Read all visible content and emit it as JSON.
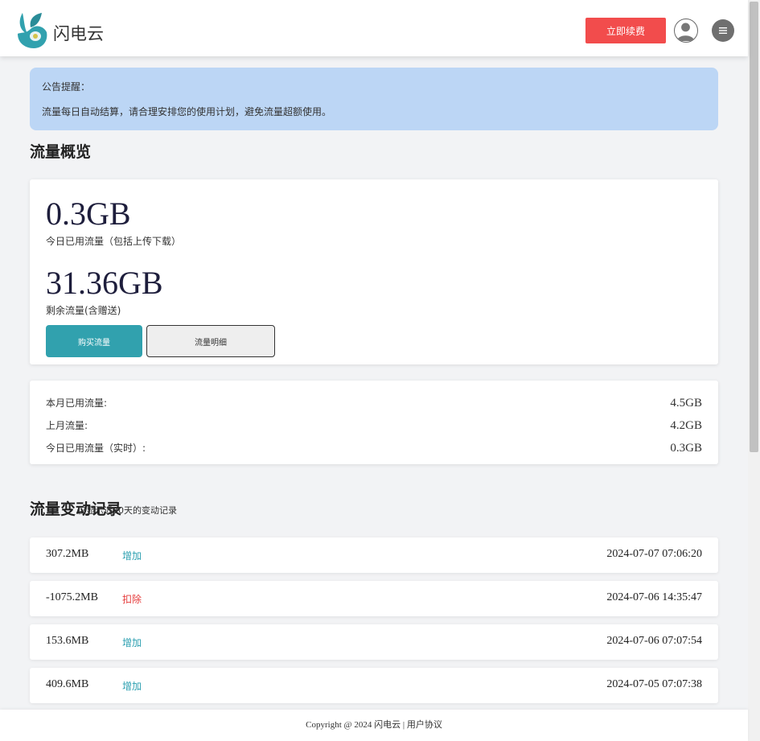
{
  "header": {
    "brand": "闪电云",
    "action_button": "立即续费",
    "avatar_icon": "user-avatar-icon",
    "menu_icon": "hamburger-menu-icon"
  },
  "notice": {
    "title": "公告提醒：",
    "body": "流量每日自动结算，请合理安排您的使用计划，避免流量超额使用。"
  },
  "summary": {
    "title": "流量概览",
    "today_value": "0.3GB",
    "today_label": "今日已用流量（包括上传下载）",
    "remaining_value": "31.36GB",
    "remaining_label": "剩余流量(含赠送)",
    "primary_button": "购买流量",
    "secondary_button": "流量明细"
  },
  "stats": [
    {
      "label": "本月已用流量:",
      "value": "4.5GB"
    },
    {
      "label": "上月流量:",
      "value": "4.2GB"
    },
    {
      "label": "今日已用流量（实时）:",
      "value": "0.3GB"
    }
  ],
  "history": {
    "title": "流量变动记录",
    "subtitle": "仅显示近30天的变动记录",
    "rows": [
      {
        "amount": "307.2MB",
        "type": "增加",
        "kind": "in",
        "time": "2024-07-07 07:06:20"
      },
      {
        "amount": "-1075.2MB",
        "type": "扣除",
        "kind": "out",
        "time": "2024-07-06 14:35:47"
      },
      {
        "amount": "153.6MB",
        "type": "增加",
        "kind": "in",
        "time": "2024-07-06 07:07:54"
      },
      {
        "amount": "409.6MB",
        "type": "增加",
        "kind": "in",
        "time": "2024-07-05 07:07:38"
      }
    ]
  },
  "footer": {
    "copyright": "Copyright @ 2024 闪电云 | 用户协议"
  },
  "colors": {
    "brand_teal": "#31a1ae",
    "action_red": "#f24c4c",
    "notice_bg": "#bcd6f5",
    "in_color": "#2b9fb0",
    "out_color": "#e53b3b"
  }
}
